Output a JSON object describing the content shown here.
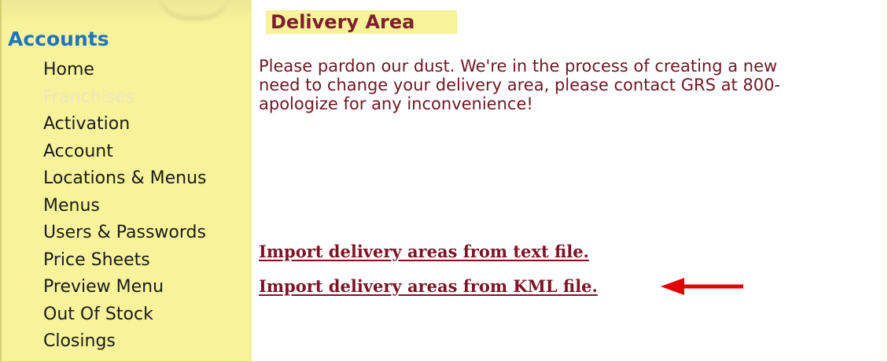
{
  "sidebar": {
    "title": "Accounts",
    "items": [
      {
        "label": "Home",
        "enabled": true
      },
      {
        "label": "Franchises",
        "enabled": false
      },
      {
        "label": "Activation",
        "enabled": true
      },
      {
        "label": "Account",
        "enabled": true
      },
      {
        "label": "Locations & Menus",
        "enabled": true
      },
      {
        "label": "Menus",
        "enabled": true
      },
      {
        "label": "Users & Passwords",
        "enabled": true
      },
      {
        "label": "Price Sheets",
        "enabled": true
      },
      {
        "label": "Preview Menu",
        "enabled": true
      },
      {
        "label": "Out Of Stock",
        "enabled": true
      },
      {
        "label": "Closings",
        "enabled": true
      }
    ]
  },
  "main": {
    "title": "Delivery Area",
    "notice_lines": [
      "Please pardon our dust. We're in the process of creating a new",
      "need to change your delivery area, please contact GRS at 800-",
      "apologize for any inconvenience!"
    ],
    "links": {
      "text_file": "Import delivery areas from text file.",
      "kml_file": "Import delivery areas from KML file."
    }
  },
  "annotation": {
    "arrow_icon": "left-arrow-icon",
    "arrow_color": "#e00000"
  },
  "colors": {
    "sidebar_background": "#f8f39a",
    "title_background": "#f8f39a",
    "accent_blue": "#1f73bf",
    "maroon": "#7b1525"
  }
}
